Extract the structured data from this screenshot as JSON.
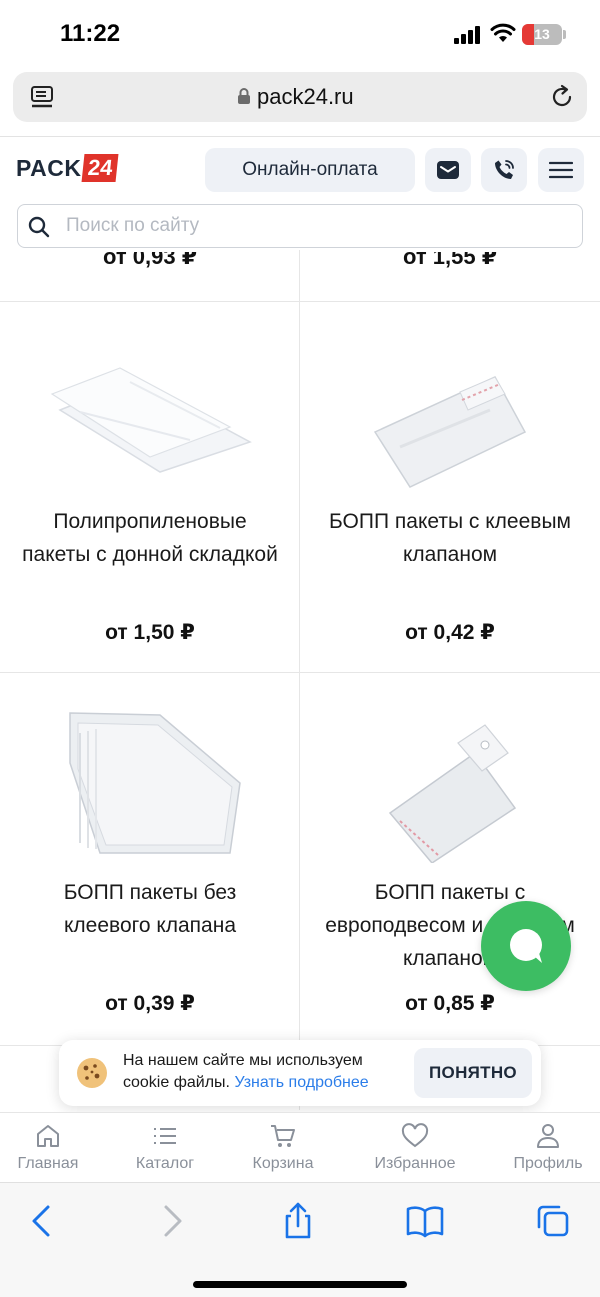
{
  "status_bar": {
    "time": "11:22",
    "battery": "13"
  },
  "browser": {
    "url": "pack24.ru"
  },
  "header": {
    "logo_text": "PACK",
    "logo_number": "24",
    "pay_label": "Онлайн-оплата"
  },
  "search": {
    "placeholder": "Поиск по сайту"
  },
  "grid": {
    "partial_prices": [
      "от 0,93 ₽",
      "от 1,55 ₽"
    ],
    "products": [
      {
        "title": "Полипропиленовые пакеты с донной складкой",
        "price": "от 1,50 ₽"
      },
      {
        "title": "БОПП пакеты с клеевым клапаном",
        "price": "от 0,42 ₽"
      },
      {
        "title": "БОПП пакеты без клеевого клапана",
        "price": "от 0,39 ₽"
      },
      {
        "title": "БОПП пакеты с европодвесом и клеевым клапаном",
        "price": "от 0,85 ₽"
      }
    ]
  },
  "cookie": {
    "text": "На нашем сайте мы используем cookie файлы.",
    "link": "Узнать подробнее",
    "button": "ПОНЯТНО"
  },
  "site_nav": {
    "items": [
      {
        "label": "Главная",
        "icon": "home-icon"
      },
      {
        "label": "Каталог",
        "icon": "catalog-icon"
      },
      {
        "label": "Корзина",
        "icon": "cart-icon"
      },
      {
        "label": "Избранное",
        "icon": "heart-icon"
      },
      {
        "label": "Профиль",
        "icon": "user-icon"
      }
    ]
  },
  "colors": {
    "brand_red": "#e0332a",
    "navy": "#1e2a3a",
    "chat_green": "#3dbd63",
    "link_blue": "#2b7de9",
    "safari_blue": "#1a73e8"
  }
}
